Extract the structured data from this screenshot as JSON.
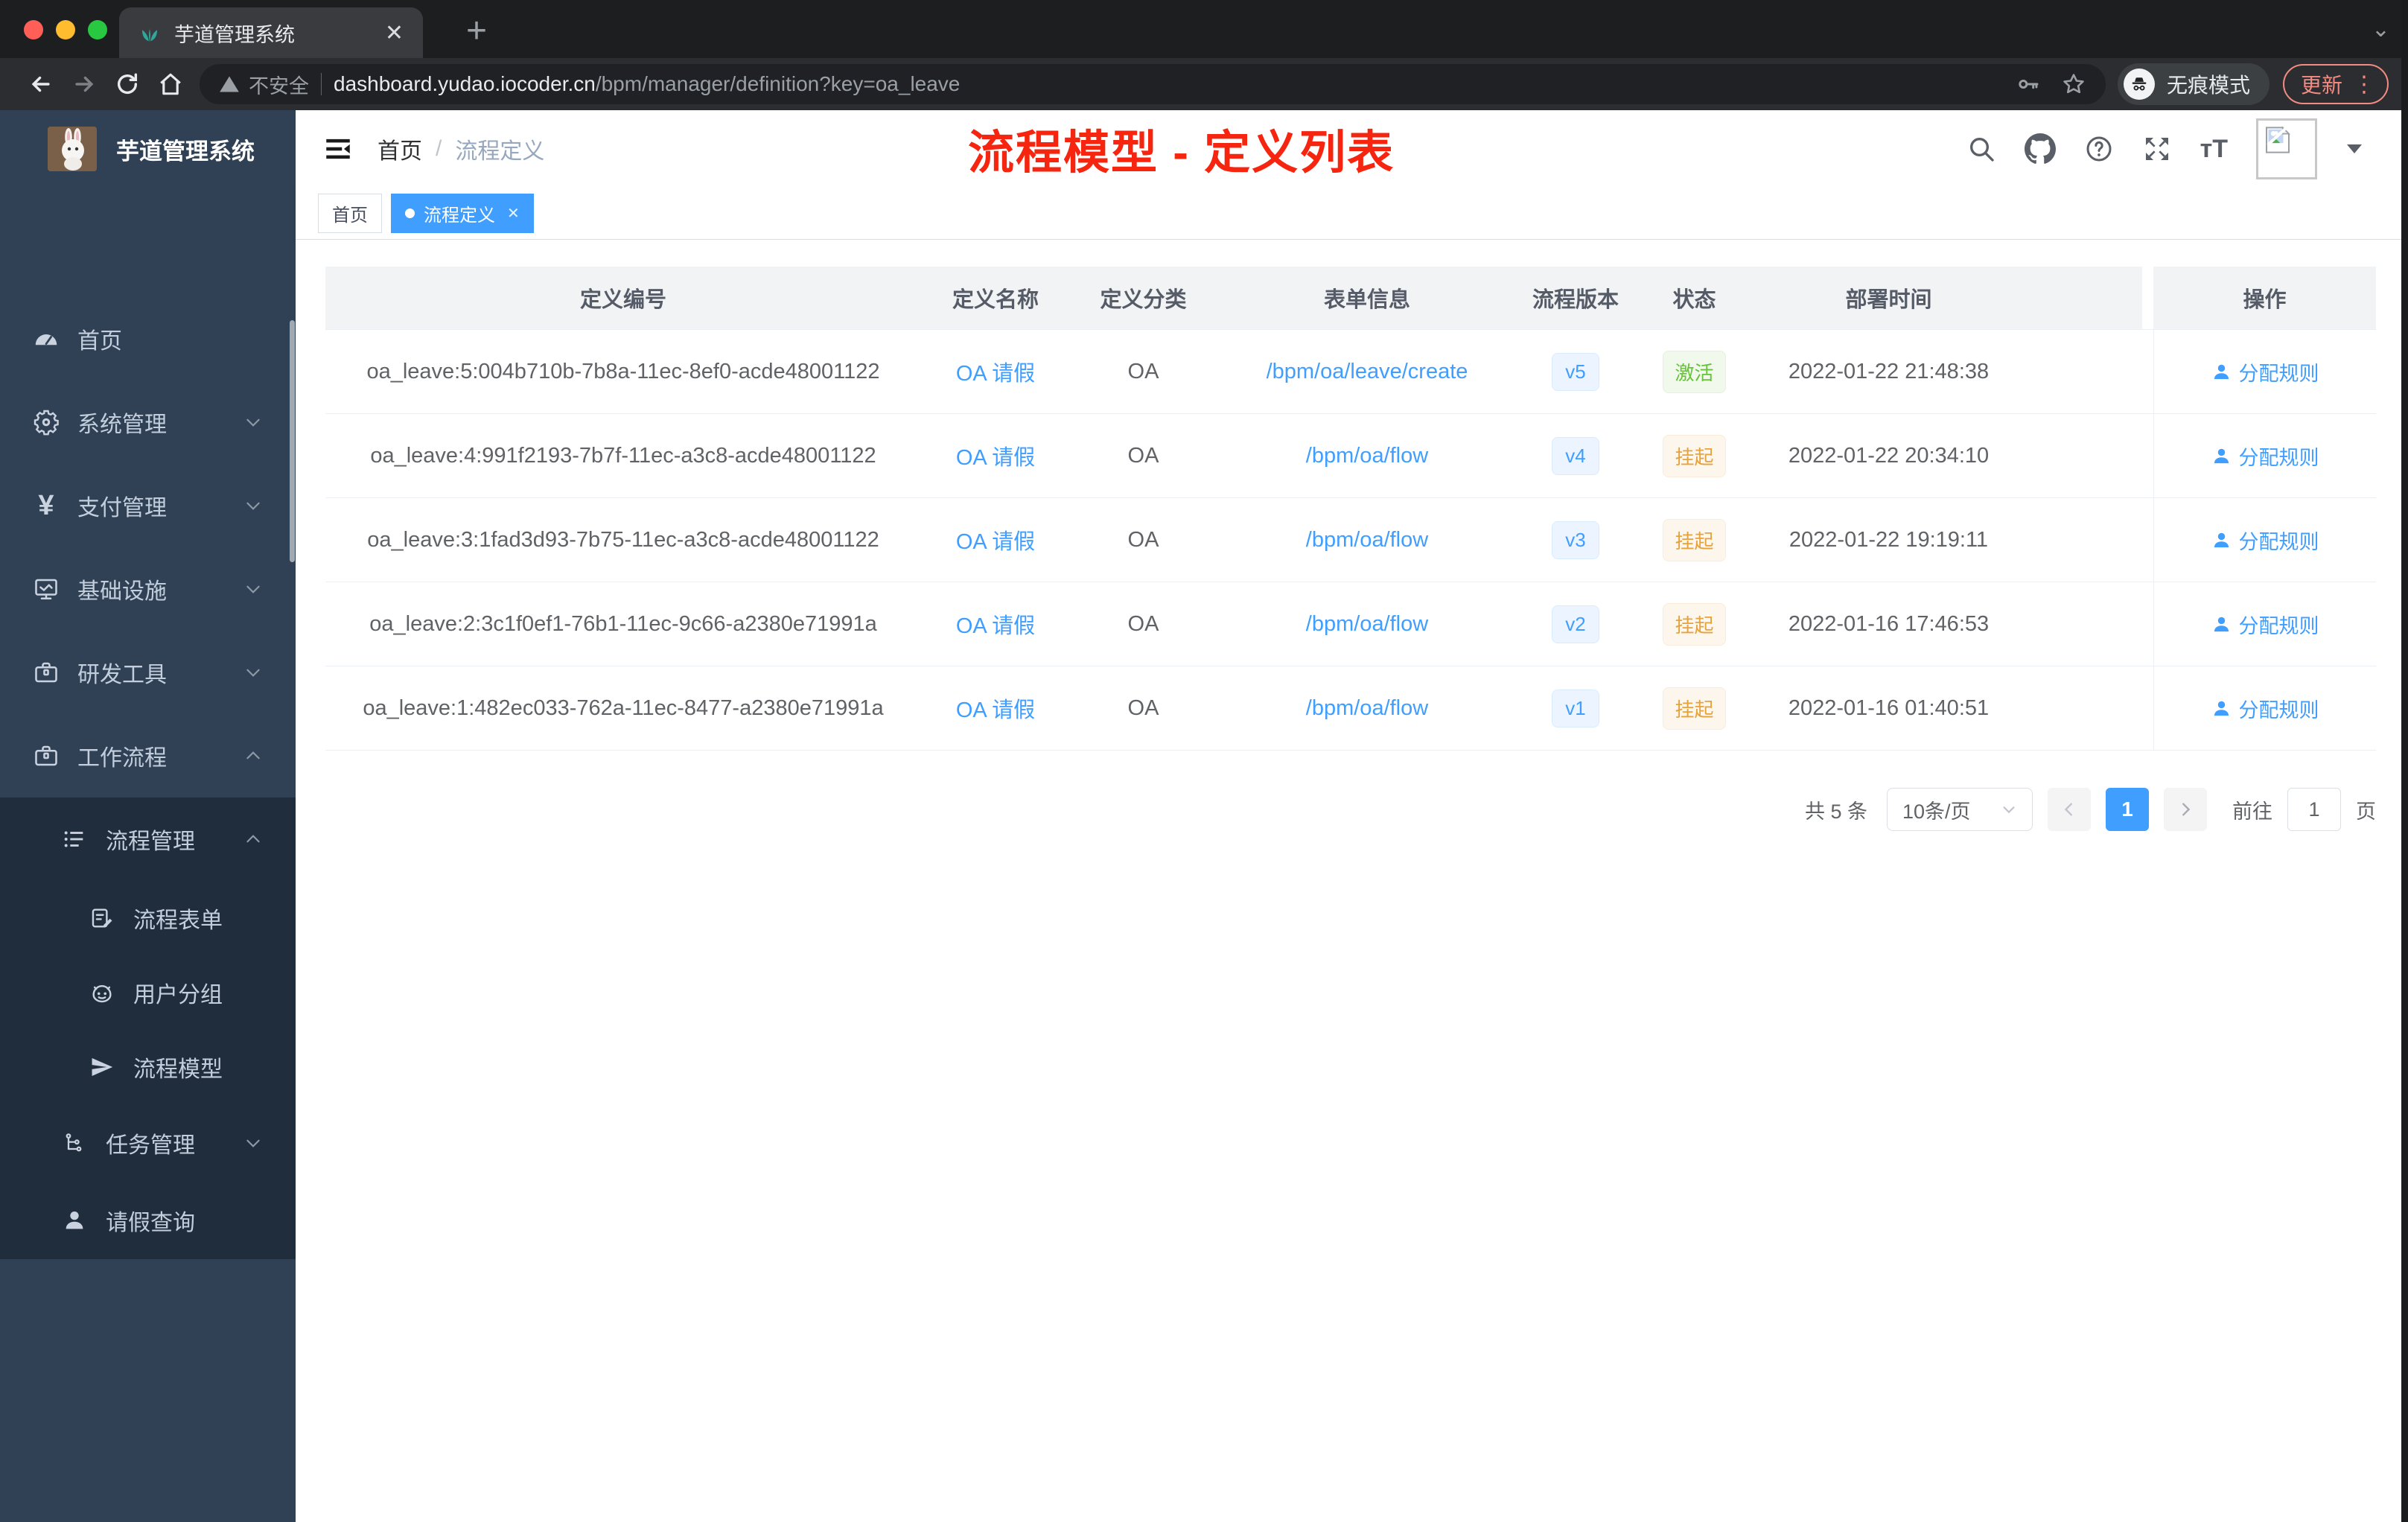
{
  "browser": {
    "tab_title": "芋道管理系统",
    "tab_close": "✕",
    "new_tab": "+",
    "tab_search": "⌄",
    "security_warning": "不安全",
    "url_host": "dashboard.yudao.iocoder.cn",
    "url_path": "/bpm/manager/definition?key=oa_leave",
    "incognito_label": "无痕模式",
    "update_label": "更新",
    "menu_dots": "⋮"
  },
  "sidebar": {
    "logo_title": "芋道管理系统",
    "items": [
      {
        "label": "首页",
        "icon": "dashboard-icon",
        "level": 1
      },
      {
        "label": "系统管理",
        "icon": "gear-icon",
        "level": 1,
        "chevron": "down"
      },
      {
        "label": "支付管理",
        "icon": "yen-icon",
        "level": 1,
        "chevron": "down"
      },
      {
        "label": "基础设施",
        "icon": "monitor-icon",
        "level": 1,
        "chevron": "down"
      },
      {
        "label": "研发工具",
        "icon": "toolbox-icon",
        "level": 1,
        "chevron": "down"
      },
      {
        "label": "工作流程",
        "icon": "briefcase-icon",
        "level": 1,
        "chevron": "up"
      },
      {
        "label": "流程管理",
        "icon": "list-tree-icon",
        "level": 2,
        "chevron": "up"
      },
      {
        "label": "流程表单",
        "icon": "form-edit-icon",
        "level": 3
      },
      {
        "label": "用户分组",
        "icon": "user-group-icon",
        "level": 3
      },
      {
        "label": "流程模型",
        "icon": "paper-plane-icon",
        "level": 3
      },
      {
        "label": "任务管理",
        "icon": "tree-icon",
        "level": 2,
        "chevron": "down"
      },
      {
        "label": "请假查询",
        "icon": "person-icon",
        "level": 2
      }
    ]
  },
  "header": {
    "breadcrumb_home": "首页",
    "breadcrumb_sep": "/",
    "breadcrumb_current": "流程定义",
    "annotation": "流程模型 - 定义列表"
  },
  "tags": [
    {
      "label": "首页",
      "active": false
    },
    {
      "label": "流程定义",
      "active": true,
      "close": "✕"
    }
  ],
  "table": {
    "columns": [
      "定义编号",
      "定义名称",
      "定义分类",
      "表单信息",
      "流程版本",
      "状态",
      "部署时间",
      "操作"
    ],
    "action_label": "分配规则",
    "rows": [
      {
        "id": "oa_leave:5:004b710b-7b8a-11ec-8ef0-acde48001122",
        "name": "OA 请假",
        "category": "OA",
        "form": "/bpm/oa/leave/create",
        "version": "v5",
        "status": "激活",
        "status_type": "green",
        "deployed_at": "2022-01-22 21:48:38",
        "action": "分配规则"
      },
      {
        "id": "oa_leave:4:991f2193-7b7f-11ec-a3c8-acde48001122",
        "name": "OA 请假",
        "category": "OA",
        "form": "/bpm/oa/flow",
        "version": "v4",
        "status": "挂起",
        "status_type": "orange",
        "deployed_at": "2022-01-22 20:34:10",
        "action": "分配规则"
      },
      {
        "id": "oa_leave:3:1fad3d93-7b75-11ec-a3c8-acde48001122",
        "name": "OA 请假",
        "category": "OA",
        "form": "/bpm/oa/flow",
        "version": "v3",
        "status": "挂起",
        "status_type": "orange",
        "deployed_at": "2022-01-22 19:19:11",
        "action": "分配规则"
      },
      {
        "id": "oa_leave:2:3c1f0ef1-76b1-11ec-9c66-a2380e71991a",
        "name": "OA 请假",
        "category": "OA",
        "form": "/bpm/oa/flow",
        "version": "v2",
        "status": "挂起",
        "status_type": "orange",
        "deployed_at": "2022-01-16 17:46:53",
        "action": "分配规则"
      },
      {
        "id": "oa_leave:1:482ec033-762a-11ec-8477-a2380e71991a",
        "name": "OA 请假",
        "category": "OA",
        "form": "/bpm/oa/flow",
        "version": "v1",
        "status": "挂起",
        "status_type": "orange",
        "deployed_at": "2022-01-16 01:40:51",
        "action": "分配规则"
      }
    ]
  },
  "pagination": {
    "total": "共 5 条",
    "page_size": "10条/页",
    "prev": "‹",
    "current_page": "1",
    "next": "›",
    "goto_label": "前往",
    "goto_value": "1",
    "unit": "页"
  },
  "colors": {
    "accent": "#409eff",
    "success": "#67c23a",
    "warning": "#e6a23c",
    "sidebar_bg": "#304156",
    "submenu_bg": "#1f2d3d",
    "annotation_red": "#f5250f",
    "header_bg": "#f2f3f5"
  }
}
